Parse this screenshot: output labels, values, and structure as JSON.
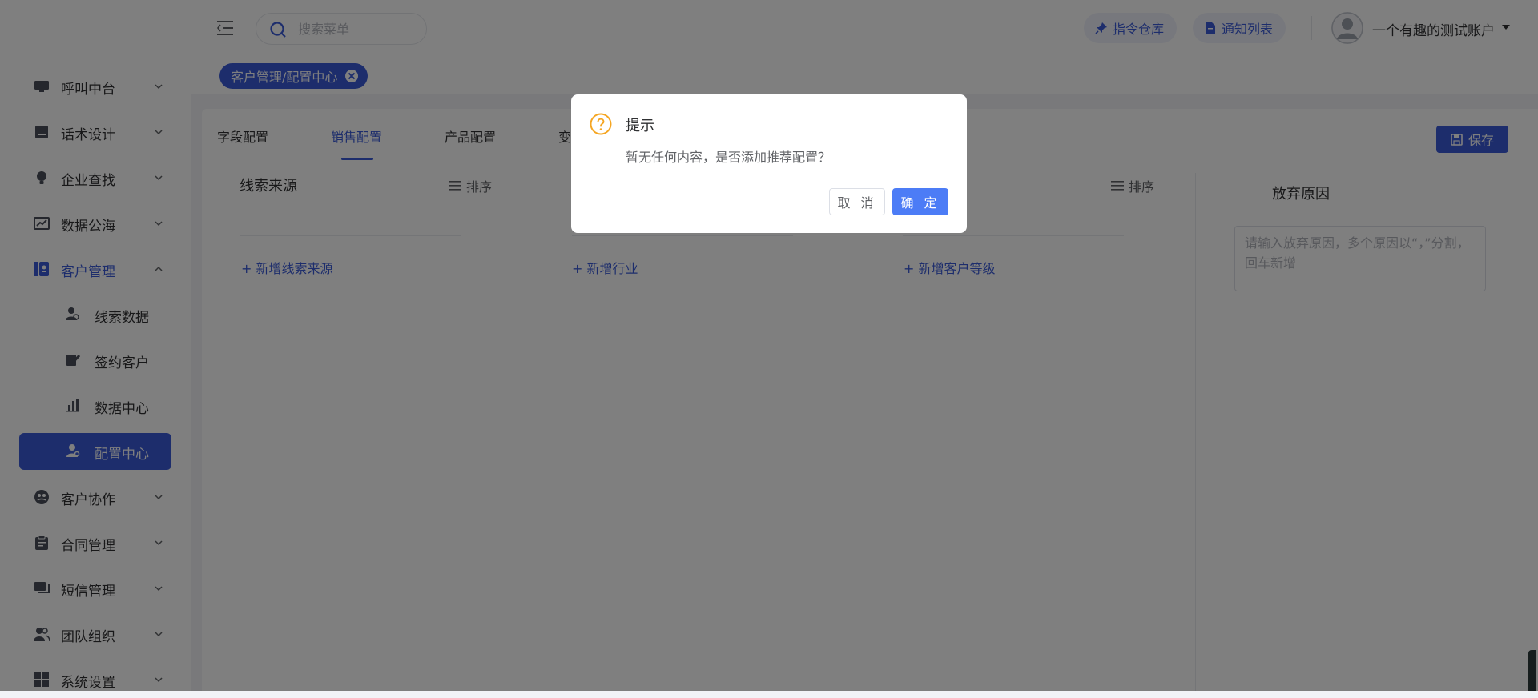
{
  "sidebar": {
    "items": [
      {
        "label": "呼叫中台",
        "icon": "monitor-icon"
      },
      {
        "label": "话术设计",
        "icon": "script-icon"
      },
      {
        "label": "企业查找",
        "icon": "lightbulb-icon"
      },
      {
        "label": "数据公海",
        "icon": "chart-icon"
      },
      {
        "label": "客户管理",
        "icon": "customer-icon",
        "expanded": true
      },
      {
        "label": "线索数据",
        "icon": "lead-icon",
        "sub": true
      },
      {
        "label": "签约客户",
        "icon": "sign-icon",
        "sub": true
      },
      {
        "label": "数据中心",
        "icon": "bar-chart-icon",
        "sub": true
      },
      {
        "label": "配置中心",
        "icon": "config-icon",
        "sub": true,
        "active": true
      },
      {
        "label": "客户协作",
        "icon": "collab-icon"
      },
      {
        "label": "合同管理",
        "icon": "contract-icon"
      },
      {
        "label": "短信管理",
        "icon": "sms-icon"
      },
      {
        "label": "团队组织",
        "icon": "team-icon"
      },
      {
        "label": "系统设置",
        "icon": "settings-icon"
      }
    ]
  },
  "header": {
    "search_placeholder": "搜索菜单",
    "command_repo": "指令仓库",
    "notice_list": "通知列表",
    "user_name": "一个有趣的测试账户"
  },
  "tags": {
    "current": "客户管理/配置中心"
  },
  "main": {
    "tabs": [
      "字段配置",
      "销售配置",
      "产品配置",
      "变"
    ],
    "active_tab": "销售配置",
    "save_label": "保存",
    "sort_label": "排序",
    "columns": {
      "lead_source_title": "线索来源",
      "add_lead_source": "+ 新增线索来源",
      "add_industry": "+ 新增行业",
      "add_customer_level": "+ 新增客户等级",
      "abandon_title": "放弃原因",
      "abandon_placeholder": "请输入放弃原因，多个原因以“，”分割，回车新增"
    }
  },
  "dialog": {
    "title": "提示",
    "message": "暂无任何内容，是否添加推荐配置？",
    "cancel_label": "取 消",
    "confirm_label": "确 定"
  },
  "colors": {
    "accent": "#3a5bd9",
    "confirm": "#4c7cf6",
    "warning": "#f5a623"
  }
}
